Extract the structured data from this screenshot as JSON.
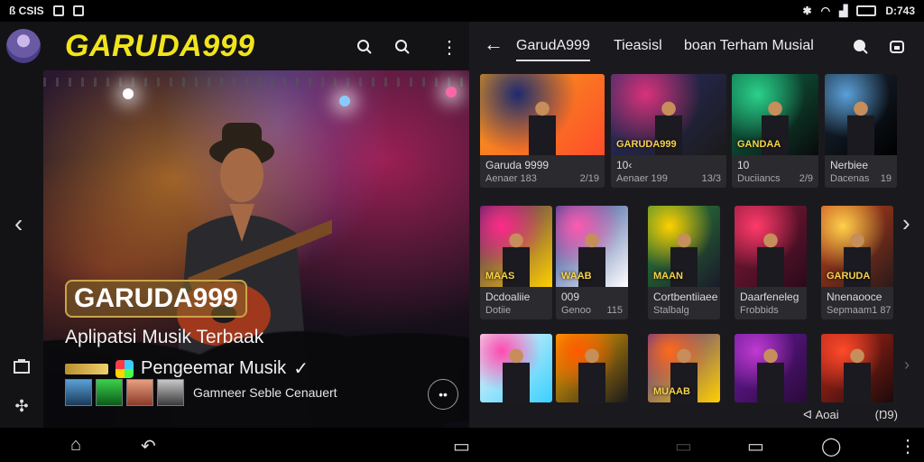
{
  "status": {
    "left_text": "ß CSIS",
    "time": "D:743"
  },
  "header": {
    "brand": "GARUDA999"
  },
  "hero": {
    "title": "GARUDA999",
    "subtitle": "Aplipatsi Musik Terbaak",
    "tagline": "Pengeemar Musik",
    "tagline_mark": "✓",
    "thumbs_label": "Gamneer Seble Cenauert"
  },
  "right_header": {
    "tabs": [
      "GarudA999",
      "Tieasisl",
      "boan Terham Musial"
    ]
  },
  "cards": [
    {
      "title": "Garuda 9999",
      "meta": "Aenaer 183",
      "count": "2/19",
      "img_text": "",
      "colors": [
        "#f3a21a",
        "#1d2a6e",
        "#ff4d2a"
      ]
    },
    {
      "title": "10‹",
      "meta": "Aenaer 199",
      "count": "13/3",
      "img_text": "GARUDA999",
      "colors": [
        "#2b2e6a",
        "#d9327a",
        "#1a1a1a"
      ]
    },
    {
      "title": "10",
      "meta": "Duciiancs",
      "count": "2/9",
      "img_text": "GANDAA",
      "colors": [
        "#0e6f4c",
        "#2bd08a",
        "#0a0a0a"
      ]
    },
    {
      "title": "Nerbiee",
      "meta": "Dacenas",
      "count": "19",
      "img_text": "",
      "colors": [
        "#1c2a3a",
        "#5aa0d8",
        "#000"
      ]
    },
    {
      "title": "Dcdoaliie",
      "meta": "Dotiie",
      "count": "",
      "img_text": "MAAS",
      "colors": [
        "#3a1a6a",
        "#ff2a8a",
        "#ffd000"
      ]
    },
    {
      "title": "009",
      "meta": "Genoo",
      "count": "115",
      "img_text": "WAAB",
      "colors": [
        "#1a3a8a",
        "#ff5ab0",
        "#ffffff"
      ]
    },
    {
      "title": "Cortbentiiaee",
      "meta": "Stalbalg",
      "count": "",
      "img_text": "MAAN",
      "colors": [
        "#2a8a3a",
        "#ffd000",
        "#1a1a2a"
      ]
    },
    {
      "title": "Daarfeneleg",
      "meta": "Frobbids",
      "count": "",
      "img_text": "",
      "colors": [
        "#8a1a3a",
        "#ff3a6a",
        "#2a0a1a"
      ]
    },
    {
      "title": "Nnenaooce",
      "meta": "Sepmaam",
      "count": "1 87",
      "img_text": "GARUDA",
      "colors": [
        "#c8401a",
        "#ffd04a",
        "#2a1a1a"
      ]
    },
    {
      "title": "",
      "meta": "",
      "count": "",
      "img_text": "",
      "colors": [
        "#f6f6f6",
        "#ff4ab0",
        "#3ad0ff"
      ]
    },
    {
      "title": "",
      "meta": "",
      "count": "",
      "img_text": "",
      "colors": [
        "#ffb000",
        "#ff5a00",
        "#1a1a1a"
      ]
    },
    {
      "title": "",
      "meta": "",
      "count": "",
      "img_text": "MUAAB",
      "colors": [
        "#4a2aa0",
        "#ff6a1a",
        "#ffd000"
      ]
    },
    {
      "title": "",
      "meta": "",
      "count": "",
      "img_text": "",
      "colors": [
        "#6a1aa0",
        "#c03ad0",
        "#2a0a3a"
      ]
    },
    {
      "title": "",
      "meta": "",
      "count": "",
      "img_text": "",
      "colors": [
        "#c0281a",
        "#ff4a2a",
        "#1a0a0a"
      ]
    }
  ],
  "footer": {
    "left": "ᐊ Aoai",
    "right": "(Ŋ9)"
  }
}
